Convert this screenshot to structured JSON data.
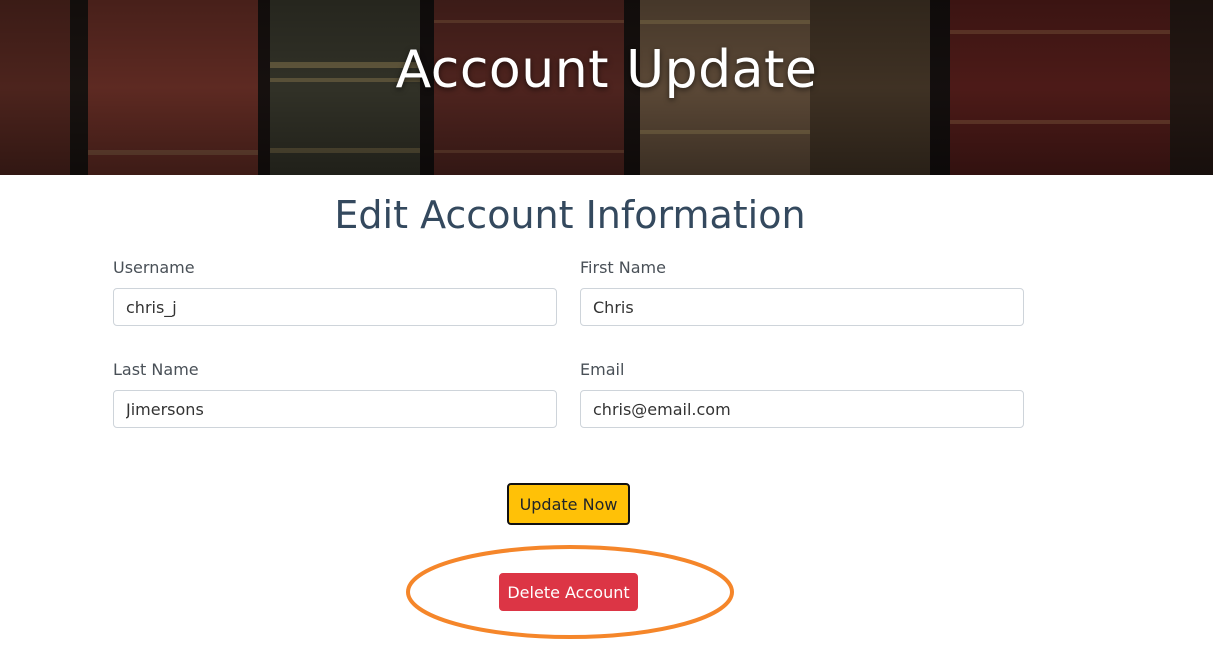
{
  "hero": {
    "title": "Account Update"
  },
  "form": {
    "title": "Edit Account Information",
    "fields": {
      "username": {
        "label": "Username",
        "value": "chris_j"
      },
      "first_name": {
        "label": "First Name",
        "value": "Chris"
      },
      "last_name": {
        "label": "Last Name",
        "value": "Jimersons"
      },
      "email": {
        "label": "Email",
        "value": "chris@email.com"
      }
    },
    "update_label": "Update Now",
    "delete_label": "Delete Account"
  },
  "colors": {
    "update_button": "#ffc107",
    "delete_button": "#dc3545",
    "title_text": "#34495e",
    "annotation_ellipse": "#f5862a"
  }
}
